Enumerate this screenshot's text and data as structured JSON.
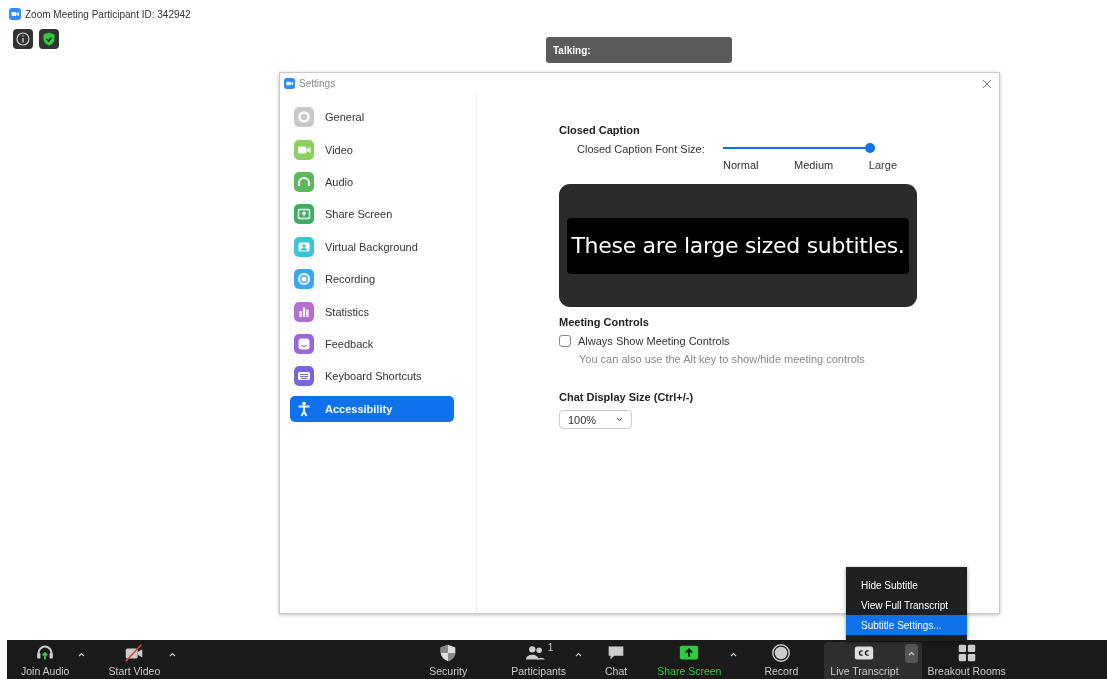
{
  "meeting_title": "Zoom Meeting Participant ID: 342942",
  "talking": "Talking:",
  "settings": {
    "title": "Settings",
    "sidebar": [
      {
        "label": "General",
        "kind": "gear",
        "selected": false
      },
      {
        "label": "Video",
        "kind": "video",
        "selected": false
      },
      {
        "label": "Audio",
        "kind": "headphones",
        "selected": false
      },
      {
        "label": "Share Screen",
        "kind": "share",
        "selected": false
      },
      {
        "label": "Virtual Background",
        "kind": "person",
        "selected": false
      },
      {
        "label": "Recording",
        "kind": "record",
        "selected": false
      },
      {
        "label": "Statistics",
        "kind": "bars",
        "selected": false
      },
      {
        "label": "Feedback",
        "kind": "smile",
        "selected": false
      },
      {
        "label": "Keyboard Shortcuts",
        "kind": "keyboard",
        "selected": false
      },
      {
        "label": "Accessibility",
        "kind": "accessibility",
        "selected": true
      }
    ],
    "closed_caption": {
      "heading": "Closed Caption",
      "slider_label": "Closed Caption Font Size:",
      "level": 1,
      "ticks": [
        "Normal",
        "Medium",
        "Large"
      ],
      "preview_text": "These are large sized subtitles."
    },
    "meeting_controls": {
      "heading": "Meeting Controls",
      "checkbox_label": "Always Show Meeting Controls",
      "checked": false,
      "hint": "You can also use the Alt key to show/hide meeting controls"
    },
    "chat_display": {
      "heading": "Chat Display Size (Ctrl+/-)",
      "value": "100%"
    }
  },
  "subtitle_menu": [
    {
      "label": "Hide Subtitle",
      "selected": false
    },
    {
      "label": "View Full Transcript",
      "selected": false
    },
    {
      "label": "Subtitle Settings...",
      "selected": true
    }
  ],
  "toolbar": [
    {
      "label": "Join Audio",
      "kind": "headphones",
      "caret": true,
      "accent": false,
      "active": false
    },
    {
      "label": "Start Video",
      "kind": "video-off",
      "caret": true,
      "accent": false,
      "active": false
    },
    {
      "label": "Security",
      "kind": "shield",
      "caret": false,
      "accent": false,
      "active": false
    },
    {
      "label": "Participants",
      "kind": "people",
      "count": "1",
      "caret": true,
      "accent": false,
      "active": false
    },
    {
      "label": "Chat",
      "kind": "chat",
      "caret": false,
      "accent": false,
      "active": false
    },
    {
      "label": "Share Screen",
      "kind": "share",
      "caret": true,
      "accent": true,
      "active": false
    },
    {
      "label": "Record",
      "kind": "record",
      "caret": false,
      "accent": false,
      "active": false
    },
    {
      "label": "Live Transcript",
      "kind": "cc",
      "caret": true,
      "accent": false,
      "active": true
    },
    {
      "label": "Breakout Rooms",
      "kind": "grid",
      "caret": false,
      "accent": false,
      "active": false
    }
  ]
}
